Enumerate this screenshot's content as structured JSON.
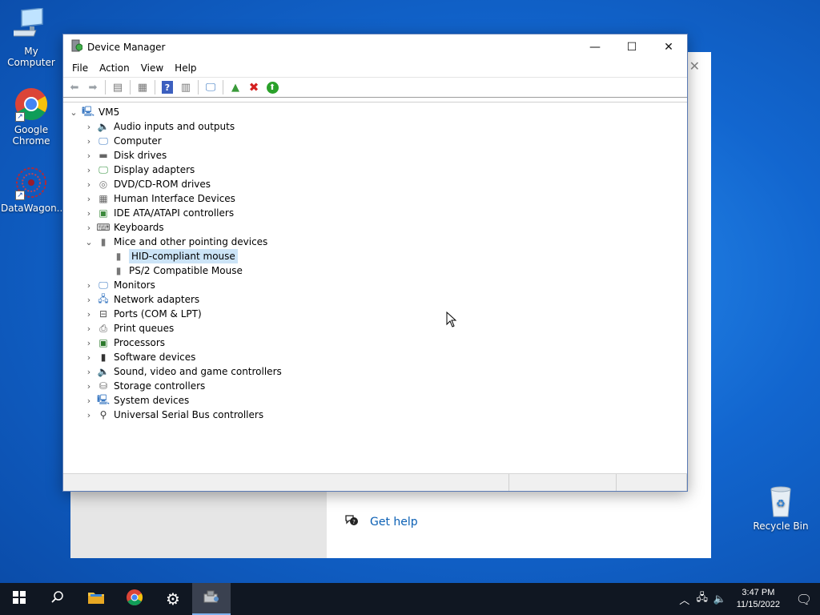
{
  "desktop": {
    "icons": [
      {
        "label": "My Computer"
      },
      {
        "label": "Google Chrome"
      },
      {
        "label": "DataWagon..."
      },
      {
        "label": "Recycle Bin"
      }
    ]
  },
  "background_window": {
    "help_link": "Get help"
  },
  "device_manager": {
    "title": "Device Manager",
    "menu": [
      "File",
      "Action",
      "View",
      "Help"
    ],
    "root": "VM5",
    "categories": [
      {
        "label": "Audio inputs and outputs",
        "icon": "speaker-icon"
      },
      {
        "label": "Computer",
        "icon": "monitor-icon"
      },
      {
        "label": "Disk drives",
        "icon": "disk-icon"
      },
      {
        "label": "Display adapters",
        "icon": "display-icon"
      },
      {
        "label": "DVD/CD-ROM drives",
        "icon": "dvd-icon"
      },
      {
        "label": "Human Interface Devices",
        "icon": "hid-icon"
      },
      {
        "label": "IDE ATA/ATAPI controllers",
        "icon": "ide-icon"
      },
      {
        "label": "Keyboards",
        "icon": "keyboard-icon"
      },
      {
        "label": "Mice and other pointing devices",
        "icon": "mouse-icon",
        "expanded": true,
        "children": [
          {
            "label": "HID-compliant mouse",
            "selected": true
          },
          {
            "label": "PS/2 Compatible Mouse"
          }
        ]
      },
      {
        "label": "Monitors",
        "icon": "monitor-icon"
      },
      {
        "label": "Network adapters",
        "icon": "network-icon"
      },
      {
        "label": "Ports (COM & LPT)",
        "icon": "port-icon"
      },
      {
        "label": "Print queues",
        "icon": "printer-icon"
      },
      {
        "label": "Processors",
        "icon": "cpu-icon"
      },
      {
        "label": "Software devices",
        "icon": "software-icon"
      },
      {
        "label": "Sound, video and game controllers",
        "icon": "speaker-icon"
      },
      {
        "label": "Storage controllers",
        "icon": "storage-icon"
      },
      {
        "label": "System devices",
        "icon": "system-icon"
      },
      {
        "label": "Universal Serial Bus controllers",
        "icon": "usb-icon"
      }
    ]
  },
  "taskbar": {
    "time": "3:47 PM",
    "date": "11/15/2022"
  },
  "colors": {
    "selection": "#cce4f7",
    "taskbar": "#101722",
    "link": "#0a5fb4"
  }
}
